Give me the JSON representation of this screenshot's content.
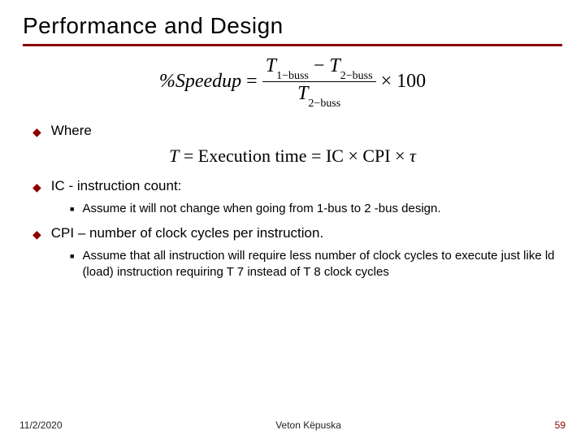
{
  "title": "Performance and Design",
  "formula_speedup": {
    "lhs": "%Speedup",
    "eq": "=",
    "num_left": "T",
    "num_left_sub": "1−buss",
    "num_minus": "−",
    "num_right": "T",
    "num_right_sub": "2−buss",
    "den": "T",
    "den_sub": "2−buss",
    "times": "×",
    "hundred": "100"
  },
  "bullets": {
    "b1": "Where",
    "b2": "IC - instruction count:",
    "b2a": "Assume it will not change when going from 1-bus to 2 -bus design.",
    "b3": "CPI – number of clock cycles per instruction.",
    "b3a": "Assume that all instruction will require less number of clock cycles to execute just like ld (load) instruction requiring T 7 instead of T 8 clock cycles"
  },
  "formula_T": "T = Execution time = IC × CPI × τ",
  "footer": {
    "date": "11/2/2020",
    "author": "Veton Këpuska",
    "page": "59"
  }
}
